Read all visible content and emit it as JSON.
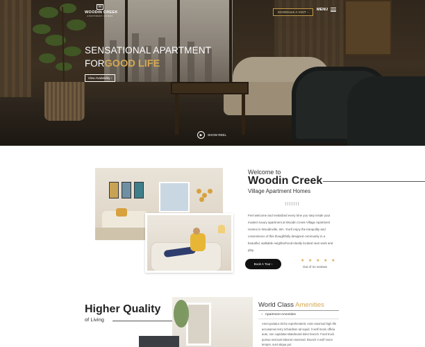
{
  "header": {
    "logo_name": "WOODIN CREEK",
    "logo_sub": "APARTMENT HOMES",
    "schedule_label": "SCHEDULE A VISIT",
    "menu_label": "MENU"
  },
  "hero": {
    "title_line1": "SENSATIONAL APARTMENT",
    "title_line2_prefix": "FOR",
    "title_line2_highlight": "GOOD LIFE",
    "cta_label": "View Availability",
    "showreel_label": "SHOW REEL"
  },
  "welcome": {
    "pre_title": "Welcome to",
    "title": "Woodin Creek",
    "subtitle": "Village Apartment Homes",
    "body": "Feel welcome and revitalized every time you step inside your modern luxury apartment at Woodin Creek Village Apartment Homes in Woodinville, WA. You'll enjoy the tranquility and convenience of this thoughtfully designed community in a beautiful, walkable neighborhood ideally located near work and play.",
    "book_label": "Book A Tour",
    "rating_stars": "★ ★ ★ ★ ★",
    "rating": 4.5,
    "reviews": "Out of 31 reviews"
  },
  "quality": {
    "title": "Higher Quality",
    "subtitle": "of Living"
  },
  "amenities": {
    "title_prefix": "World Class",
    "title_highlight": "Amenities",
    "item_label": "Apartment Amenities",
    "body": "Amet pariatur cliche reprehenderit, enim eiusmod high life accusamus terry richardson ad squid. 3 wolf moon officia aute, non cupidatat skateboard dolor brunch. Food truck quinoa nesciunt laborum eiusmod. Brunch 3 wolf moon tempor, sunt aliqua put"
  },
  "colors": {
    "accent": "#d4a853",
    "dark": "#111111"
  },
  "icons": [
    "play-icon",
    "hamburger-icon",
    "chevron-right-icon",
    "star-icon",
    "minus-icon"
  ]
}
